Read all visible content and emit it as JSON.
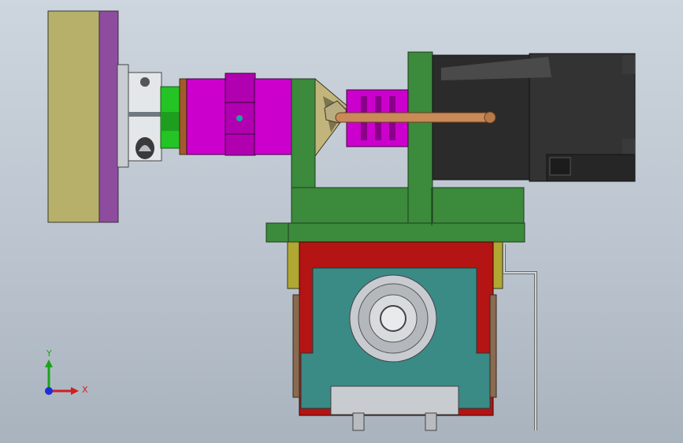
{
  "triad": {
    "y_label": "Y",
    "x_label": "X",
    "y_color": "#1aa31a",
    "x_color": "#d21e1e",
    "z_color": "#1c2fd6"
  },
  "colors": {
    "background_top": "#cdd5de",
    "background_bottom": "#a9b3bd",
    "base_plate": "#b6b06b",
    "flange_plate": "#8e4c9e",
    "coupling_silver": "#d4d8dc",
    "green_collar": "#23c423",
    "magenta_body": "#cc00cc",
    "bracket_green": "#3c8a3c",
    "motor_black": "#2b2b2b",
    "copper_rod": "#c98a58",
    "teal_housing": "#3a8a86",
    "red_frame": "#b41414",
    "olive_clamp": "#b0a833"
  }
}
